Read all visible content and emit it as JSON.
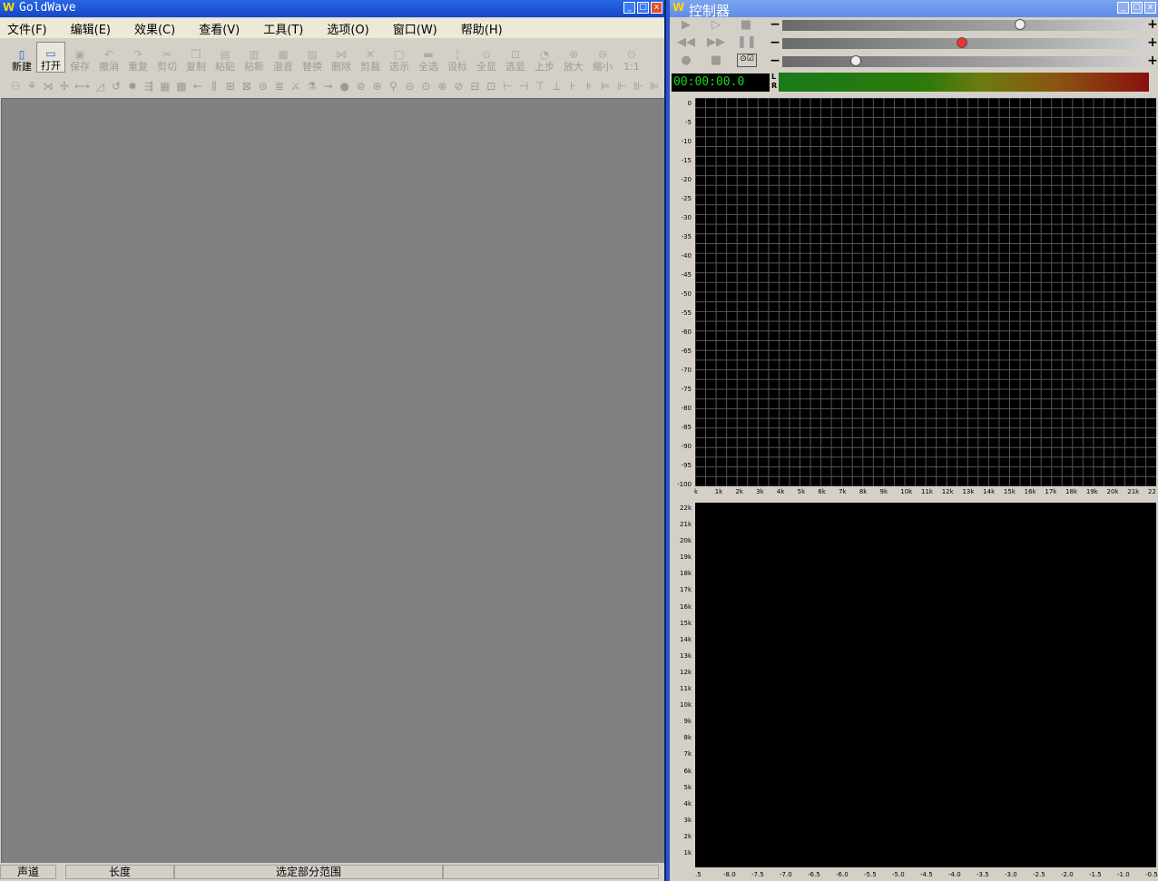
{
  "main_window": {
    "icon": "W",
    "title": "GoldWave",
    "controls": {
      "minimize": "_",
      "maximize": "□",
      "close": "x"
    },
    "menu": [
      "文件(F)",
      "编辑(E)",
      "效果(C)",
      "查看(V)",
      "工具(T)",
      "选项(O)",
      "窗口(W)",
      "帮助(H)"
    ],
    "toolbar": [
      {
        "label": "新建",
        "icon": "new-file-icon",
        "enabled": true
      },
      {
        "label": "打开",
        "icon": "open-folder-icon",
        "enabled": true
      },
      {
        "label": "保存",
        "icon": "save-icon",
        "enabled": false
      },
      {
        "label": "撤消",
        "icon": "undo-icon",
        "enabled": false
      },
      {
        "label": "重复",
        "icon": "redo-icon",
        "enabled": false
      },
      {
        "label": "剪切",
        "icon": "cut-icon",
        "enabled": false
      },
      {
        "label": "复制",
        "icon": "copy-icon",
        "enabled": false
      },
      {
        "label": "粘贴",
        "icon": "paste-icon",
        "enabled": false
      },
      {
        "label": "粘新",
        "icon": "paste-new-icon",
        "enabled": false
      },
      {
        "label": "混音",
        "icon": "mix-icon",
        "enabled": false
      },
      {
        "label": "替换",
        "icon": "replace-icon",
        "enabled": false
      },
      {
        "label": "删除",
        "icon": "delete-icon",
        "enabled": false
      },
      {
        "label": "剪裁",
        "icon": "trim-icon",
        "enabled": false
      },
      {
        "label": "选示",
        "icon": "select-view-icon",
        "enabled": false
      },
      {
        "label": "全选",
        "icon": "select-all-icon",
        "enabled": false
      },
      {
        "label": "设标",
        "icon": "set-marker-icon",
        "enabled": false
      },
      {
        "label": "全显",
        "icon": "view-all-icon",
        "enabled": false
      },
      {
        "label": "选显",
        "icon": "view-selection-icon",
        "enabled": false
      },
      {
        "label": "上步",
        "icon": "previous-step-icon",
        "enabled": false
      },
      {
        "label": "放大",
        "icon": "zoom-in-icon",
        "enabled": false
      },
      {
        "label": "缩小",
        "icon": "zoom-out-icon",
        "enabled": false
      },
      {
        "label": "1:1",
        "icon": "zoom-reset-icon",
        "enabled": false
      }
    ],
    "effects_toolbar_count": 40,
    "status": [
      "声道",
      "长度",
      "选定部分范围",
      ""
    ]
  },
  "controller_window": {
    "icon": "W",
    "title": "控制器",
    "time": "00:00:00.0",
    "lr_labels": [
      "L",
      "R"
    ],
    "spectrum_y_ticks": [
      "0",
      "-5",
      "-10",
      "-15",
      "-20",
      "-25",
      "-30",
      "-35",
      "-40",
      "-45",
      "-50",
      "-55",
      "-60",
      "-65",
      "-70",
      "-75",
      "-80",
      "-85",
      "-90",
      "-95",
      "-100"
    ],
    "spectrum_x_ticks": [
      "k",
      "1k",
      "2k",
      "3k",
      "4k",
      "5k",
      "6k",
      "7k",
      "8k",
      "9k",
      "10k",
      "11k",
      "12k",
      "13k",
      "14k",
      "15k",
      "16k",
      "17k",
      "18k",
      "19k",
      "20k",
      "21k",
      "22"
    ],
    "spectrogram_y_ticks": [
      "22k",
      "21k",
      "20k",
      "19k",
      "18k",
      "17k",
      "16k",
      "15k",
      "14k",
      "13k",
      "12k",
      "11k",
      "10k",
      "9k",
      "8k",
      "7k",
      "6k",
      "5k",
      "4k",
      "3k",
      "2k",
      "1k"
    ],
    "spectrogram_x_ticks": [
      ".5",
      "-8.0",
      "-7.5",
      "-7.0",
      "-6.5",
      "-6.0",
      "-5.5",
      "-5.0",
      "-4.5",
      "-4.0",
      "-3.5",
      "-3.0",
      "-2.5",
      "-2.0",
      "-1.5",
      "-1.0",
      "-0.5"
    ],
    "slider_levels": [
      0.68,
      0.51,
      0.2
    ],
    "colors": {
      "title_active": "#1546c8",
      "title_inactive": "#6b93e8",
      "timer": "#17d917",
      "grid": "#555555"
    }
  }
}
